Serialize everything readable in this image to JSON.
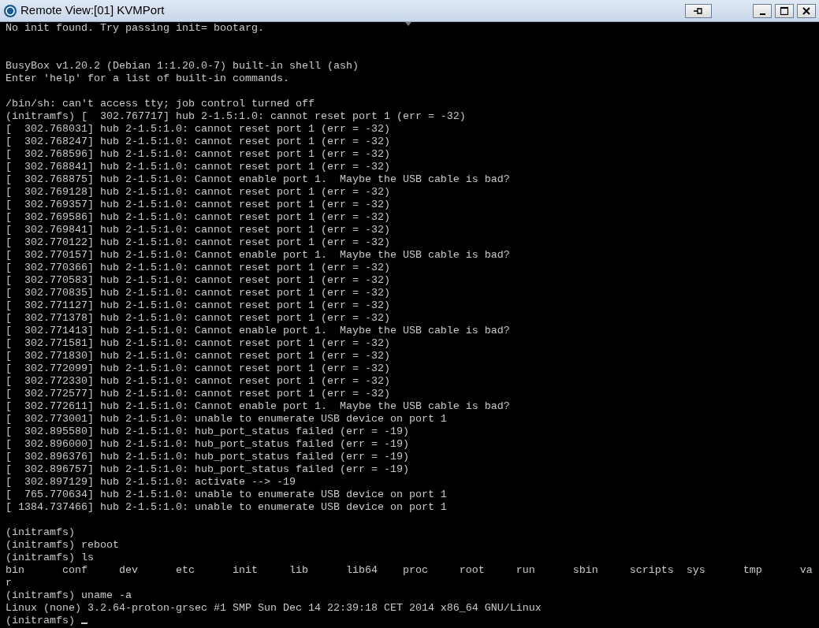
{
  "window": {
    "title": "Remote View:[01] KVMPort"
  },
  "console": {
    "lines": [
      {
        "kind": "text",
        "text": "No init found. Try passing init= bootarg."
      },
      {
        "kind": "blank"
      },
      {
        "kind": "blank"
      },
      {
        "kind": "text",
        "text": "BusyBox v1.20.2 (Debian 1:1.20.0-7) built-in shell (ash)"
      },
      {
        "kind": "text",
        "text": "Enter 'help' for a list of built-in commands."
      },
      {
        "kind": "blank"
      },
      {
        "kind": "text",
        "text": "/bin/sh: can't access tty; job control turned off"
      },
      {
        "kind": "text",
        "text": "(initramfs) [  302.767717] hub 2-1.5:1.0: cannot reset port 1 (err = -32)"
      },
      {
        "kind": "text",
        "text": "[  302.768031] hub 2-1.5:1.0: cannot reset port 1 (err = -32)"
      },
      {
        "kind": "text",
        "text": "[  302.768247] hub 2-1.5:1.0: cannot reset port 1 (err = -32)"
      },
      {
        "kind": "text",
        "text": "[  302.768596] hub 2-1.5:1.0: cannot reset port 1 (err = -32)"
      },
      {
        "kind": "text",
        "text": "[  302.768841] hub 2-1.5:1.0: cannot reset port 1 (err = -32)"
      },
      {
        "kind": "text",
        "text": "[  302.768875] hub 2-1.5:1.0: Cannot enable port 1.  Maybe the USB cable is bad?"
      },
      {
        "kind": "text",
        "text": "[  302.769128] hub 2-1.5:1.0: cannot reset port 1 (err = -32)"
      },
      {
        "kind": "text",
        "text": "[  302.769357] hub 2-1.5:1.0: cannot reset port 1 (err = -32)"
      },
      {
        "kind": "text",
        "text": "[  302.769586] hub 2-1.5:1.0: cannot reset port 1 (err = -32)"
      },
      {
        "kind": "text",
        "text": "[  302.769841] hub 2-1.5:1.0: cannot reset port 1 (err = -32)"
      },
      {
        "kind": "text",
        "text": "[  302.770122] hub 2-1.5:1.0: cannot reset port 1 (err = -32)"
      },
      {
        "kind": "text",
        "text": "[  302.770157] hub 2-1.5:1.0: Cannot enable port 1.  Maybe the USB cable is bad?"
      },
      {
        "kind": "text",
        "text": "[  302.770366] hub 2-1.5:1.0: cannot reset port 1 (err = -32)"
      },
      {
        "kind": "text",
        "text": "[  302.770583] hub 2-1.5:1.0: cannot reset port 1 (err = -32)"
      },
      {
        "kind": "text",
        "text": "[  302.770835] hub 2-1.5:1.0: cannot reset port 1 (err = -32)"
      },
      {
        "kind": "text",
        "text": "[  302.771127] hub 2-1.5:1.0: cannot reset port 1 (err = -32)"
      },
      {
        "kind": "text",
        "text": "[  302.771378] hub 2-1.5:1.0: cannot reset port 1 (err = -32)"
      },
      {
        "kind": "text",
        "text": "[  302.771413] hub 2-1.5:1.0: Cannot enable port 1.  Maybe the USB cable is bad?"
      },
      {
        "kind": "text",
        "text": "[  302.771581] hub 2-1.5:1.0: cannot reset port 1 (err = -32)"
      },
      {
        "kind": "text",
        "text": "[  302.771830] hub 2-1.5:1.0: cannot reset port 1 (err = -32)"
      },
      {
        "kind": "text",
        "text": "[  302.772099] hub 2-1.5:1.0: cannot reset port 1 (err = -32)"
      },
      {
        "kind": "text",
        "text": "[  302.772330] hub 2-1.5:1.0: cannot reset port 1 (err = -32)"
      },
      {
        "kind": "text",
        "text": "[  302.772577] hub 2-1.5:1.0: cannot reset port 1 (err = -32)"
      },
      {
        "kind": "text",
        "text": "[  302.772611] hub 2-1.5:1.0: Cannot enable port 1.  Maybe the USB cable is bad?"
      },
      {
        "kind": "text",
        "text": "[  302.773001] hub 2-1.5:1.0: unable to enumerate USB device on port 1"
      },
      {
        "kind": "text",
        "text": "[  302.895580] hub 2-1.5:1.0: hub_port_status failed (err = -19)"
      },
      {
        "kind": "text",
        "text": "[  302.896000] hub 2-1.5:1.0: hub_port_status failed (err = -19)"
      },
      {
        "kind": "text",
        "text": "[  302.896376] hub 2-1.5:1.0: hub_port_status failed (err = -19)"
      },
      {
        "kind": "text",
        "text": "[  302.896757] hub 2-1.5:1.0: hub_port_status failed (err = -19)"
      },
      {
        "kind": "text",
        "text": "[  302.897129] hub 2-1.5:1.0: activate --> -19"
      },
      {
        "kind": "text",
        "text": "[  765.770634] hub 2-1.5:1.0: unable to enumerate USB device on port 1"
      },
      {
        "kind": "text",
        "text": "[ 1384.737466] hub 2-1.5:1.0: unable to enumerate USB device on port 1"
      },
      {
        "kind": "blank"
      },
      {
        "kind": "text",
        "text": "(initramfs)"
      },
      {
        "kind": "text",
        "text": "(initramfs) reboot"
      },
      {
        "kind": "text",
        "text": "(initramfs) ls"
      },
      {
        "kind": "text",
        "text": "bin      conf     dev      etc      init     lib      lib64    proc     root     run      sbin     scripts  sys      tmp      va"
      },
      {
        "kind": "text",
        "text": "r"
      },
      {
        "kind": "text",
        "text": "(initramfs) uname -a"
      },
      {
        "kind": "text",
        "text": "Linux (none) 3.2.64-proton-grsec #1 SMP Sun Dec 14 22:39:18 CET 2014 x86_64 GNU/Linux"
      },
      {
        "kind": "prompt",
        "text": "(initramfs) "
      }
    ]
  }
}
